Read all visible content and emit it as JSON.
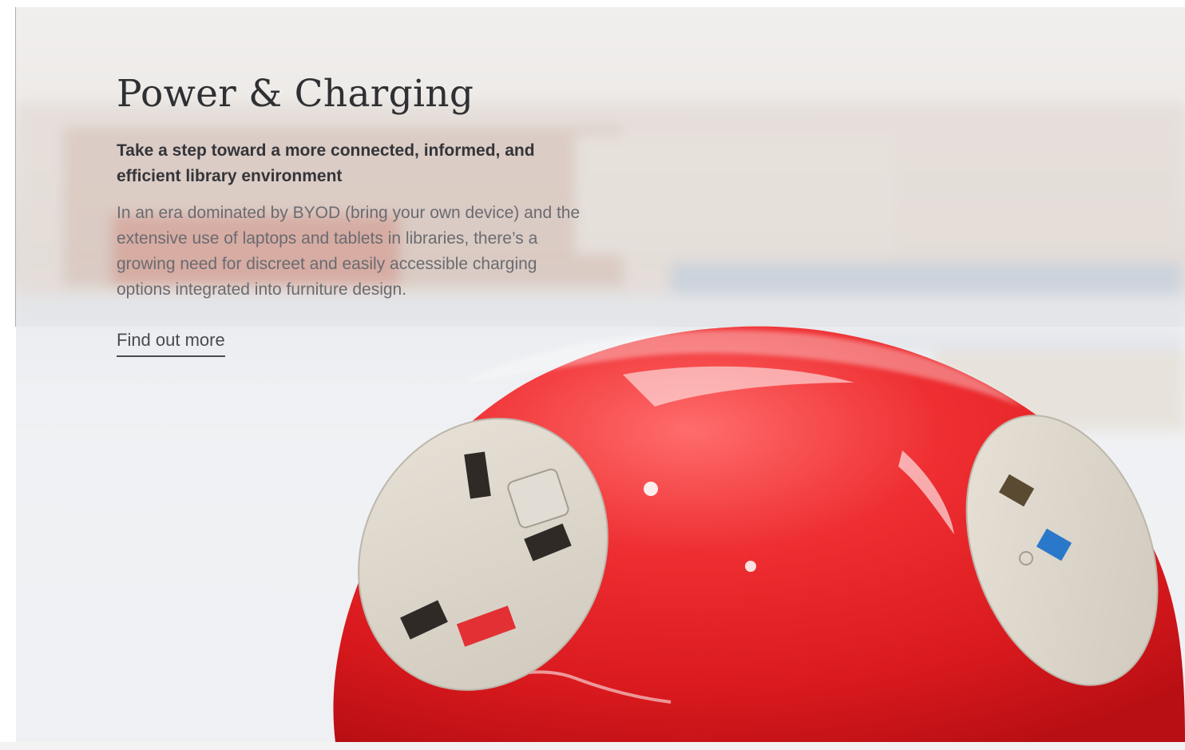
{
  "section": {
    "title": "Power & Charging",
    "subtitle": "Take a step toward a more connected, informed, and efficient library environment",
    "body": "In an era dominated by BYOD (bring your own device) and the extensive use of laptops and tablets in libraries, there’s a growing need for discreet and easily accessible charging options integrated into furniture design.",
    "cta_label": "Find out more"
  },
  "image": {
    "subject": "red-power-charging-dome-with-uk-socket-and-usb-ports",
    "accent_color": "#e8282c"
  }
}
